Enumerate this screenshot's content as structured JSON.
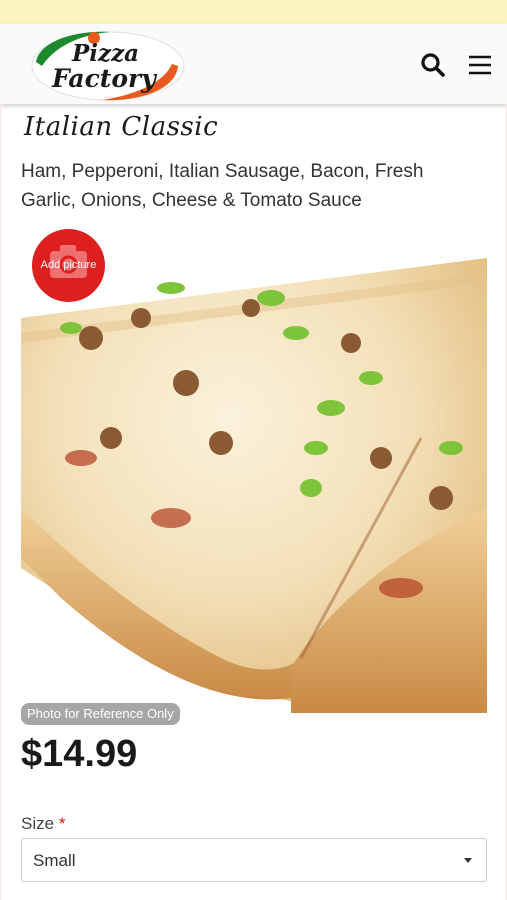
{
  "header": {
    "logo_line1": "Pizza",
    "logo_line2": "Factory",
    "search_icon": "search-icon",
    "menu_icon": "hamburger-menu-icon"
  },
  "item": {
    "title": "Italian Classic",
    "description": "Ham, Pepperoni, Italian Sausage, Bacon, Fresh Garlic, Onions, Cheese & Tomato Sauce",
    "add_picture_label": "Add picture",
    "photo_badge": "Photo for Reference Only",
    "price": "$14.99"
  },
  "options": {
    "size_label": "Size",
    "required_mark": "*",
    "size_value": "Small"
  },
  "colors": {
    "banner": "#fbf3bd",
    "brand_red": "#dd1f1f",
    "logo_green": "#1e8a2e",
    "logo_orange": "#e85a1f"
  }
}
